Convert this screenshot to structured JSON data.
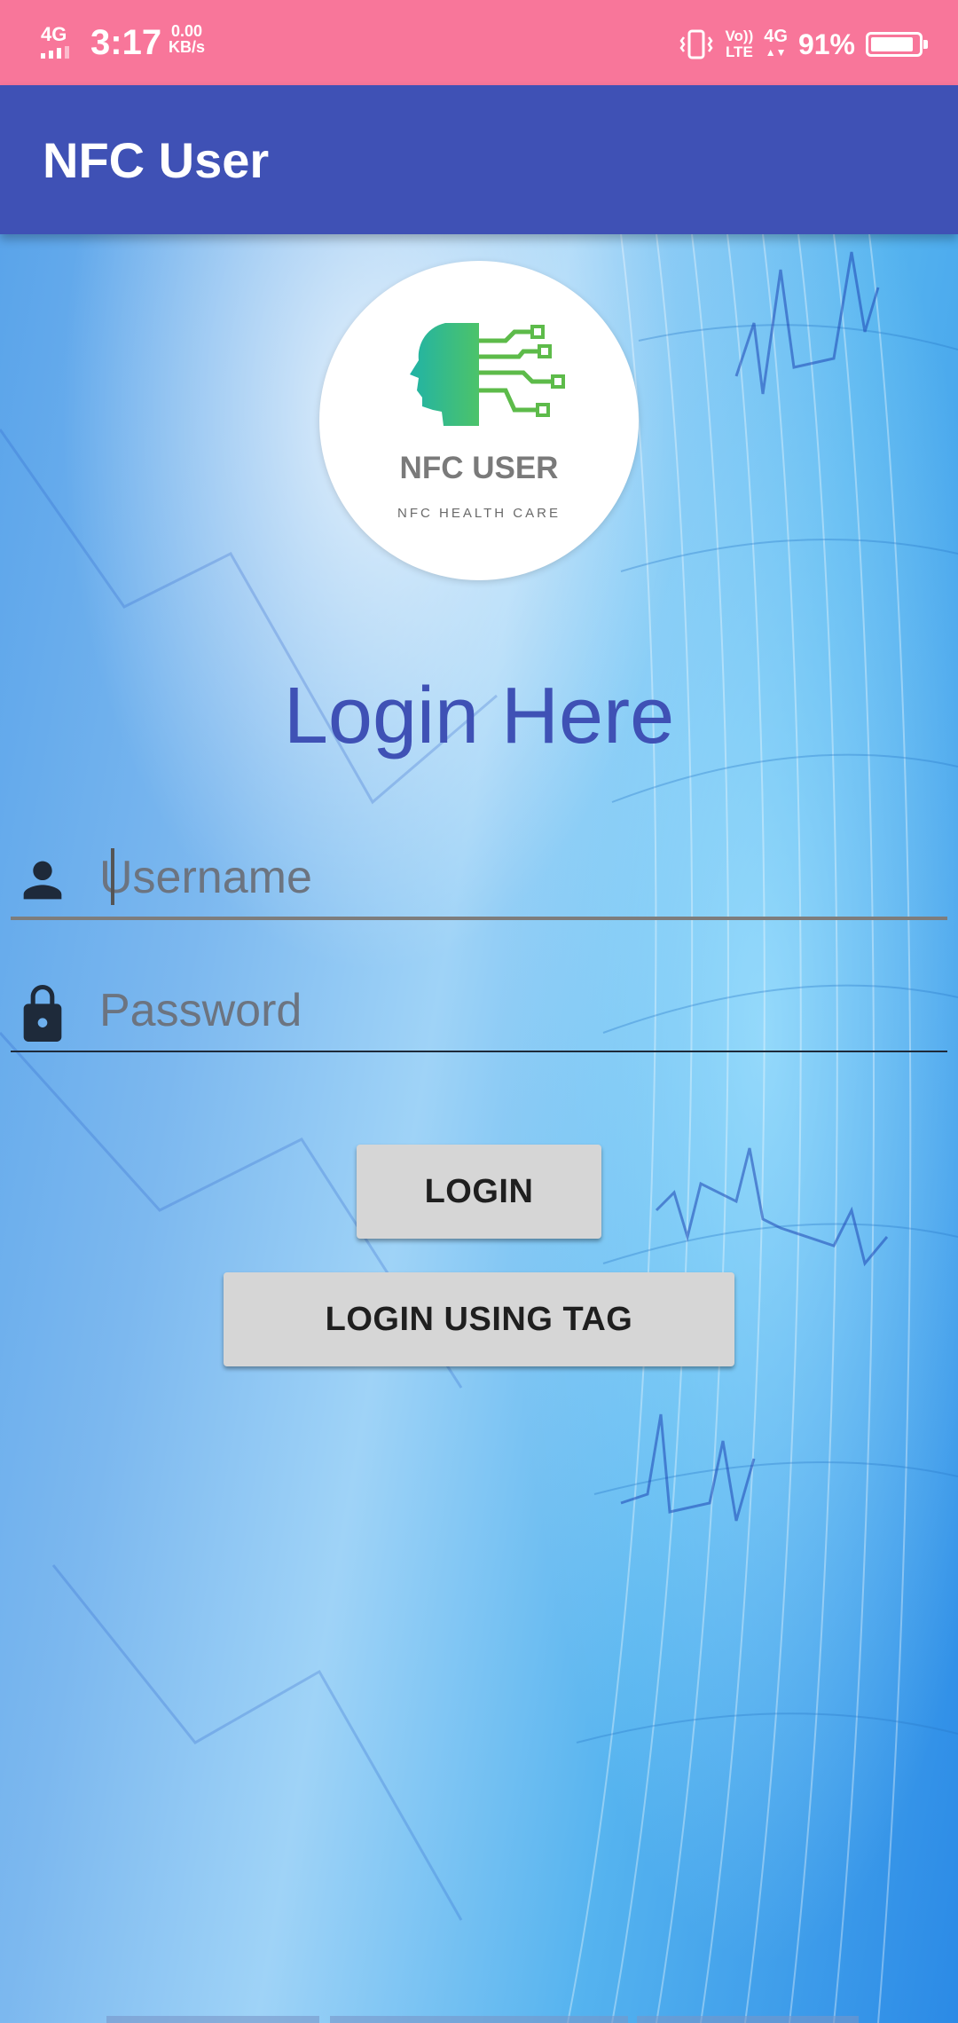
{
  "status_bar": {
    "network": "4G",
    "time": "3:17",
    "speed_value": "0.00",
    "speed_unit": "KB/s",
    "volte_top": "Vo))",
    "volte_bottom": "LTE",
    "network_right": "4G",
    "battery": "91%",
    "battery_level": 0.91
  },
  "app_bar": {
    "title": "NFC User"
  },
  "logo": {
    "title": "NFC USER",
    "subtitle": "NFC HEALTH CARE"
  },
  "login": {
    "heading": "Login Here",
    "username_placeholder": "Username",
    "username_value": "",
    "password_placeholder": "Password",
    "password_value": "",
    "login_button": "LOGIN",
    "login_tag_button": "LOGIN USING TAG"
  },
  "colors": {
    "status_bar": "#f8769a",
    "app_bar": "#3f51b5",
    "heading": "#3f51b5",
    "button": "#d6d6d6"
  },
  "icons": [
    "vibrate-icon",
    "battery-icon",
    "person-icon",
    "lock-icon",
    "brain-circuit-icon"
  ]
}
